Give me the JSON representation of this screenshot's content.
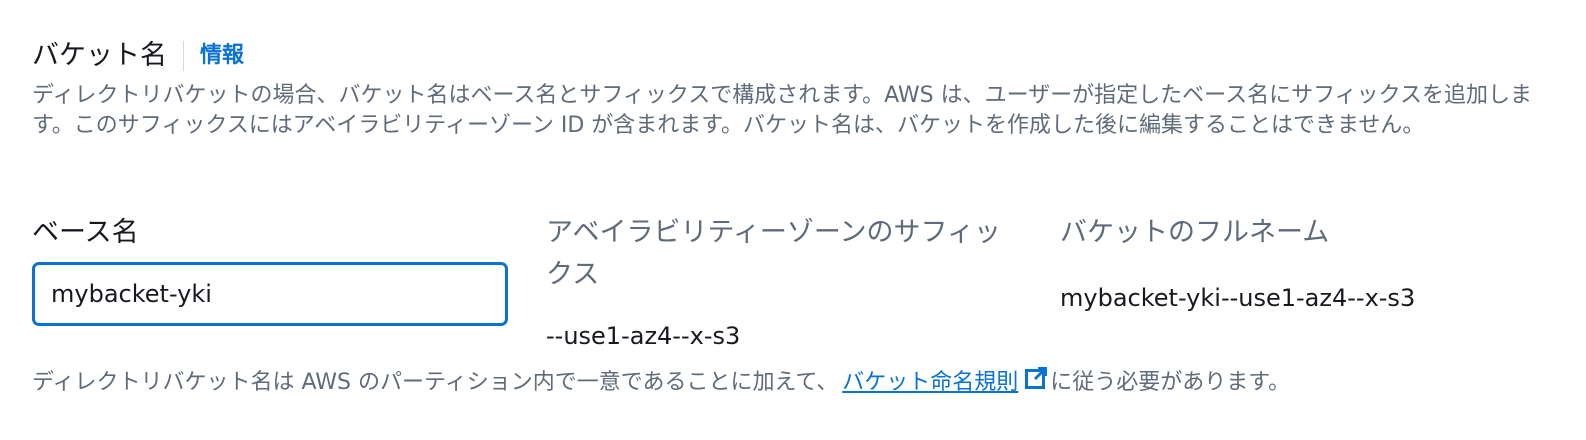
{
  "header": {
    "title": "バケット名",
    "info_link": "情報"
  },
  "description": "ディレクトリバケットの場合、バケット名はベース名とサフィックスで構成されます。AWS は、ユーザーが指定したベース名にサフィックスを追加します。このサフィックスにはアベイラビリティーゾーン ID が含まれます。バケット名は、バケットを作成した後に編集することはできません。",
  "base_name": {
    "label": "ベース名",
    "value": "mybacket-yki"
  },
  "suffix": {
    "label": "アベイラビリティーゾーンのサフィックス",
    "value": "--use1-az4--x-s3"
  },
  "full_name": {
    "label": "バケットのフルネーム",
    "value": "mybacket-yki--use1-az4--x-s3"
  },
  "footer": {
    "text_before": "ディレクトリバケット名は AWS のパーティション内で一意であることに加えて、",
    "link_text": "バケット命名規則",
    "text_after": "に従う必要があります。",
    "link_icon": "external-link-icon"
  },
  "colors": {
    "accent": "#0972d3",
    "text_primary": "#16191f",
    "text_secondary": "#5f6b7a"
  }
}
